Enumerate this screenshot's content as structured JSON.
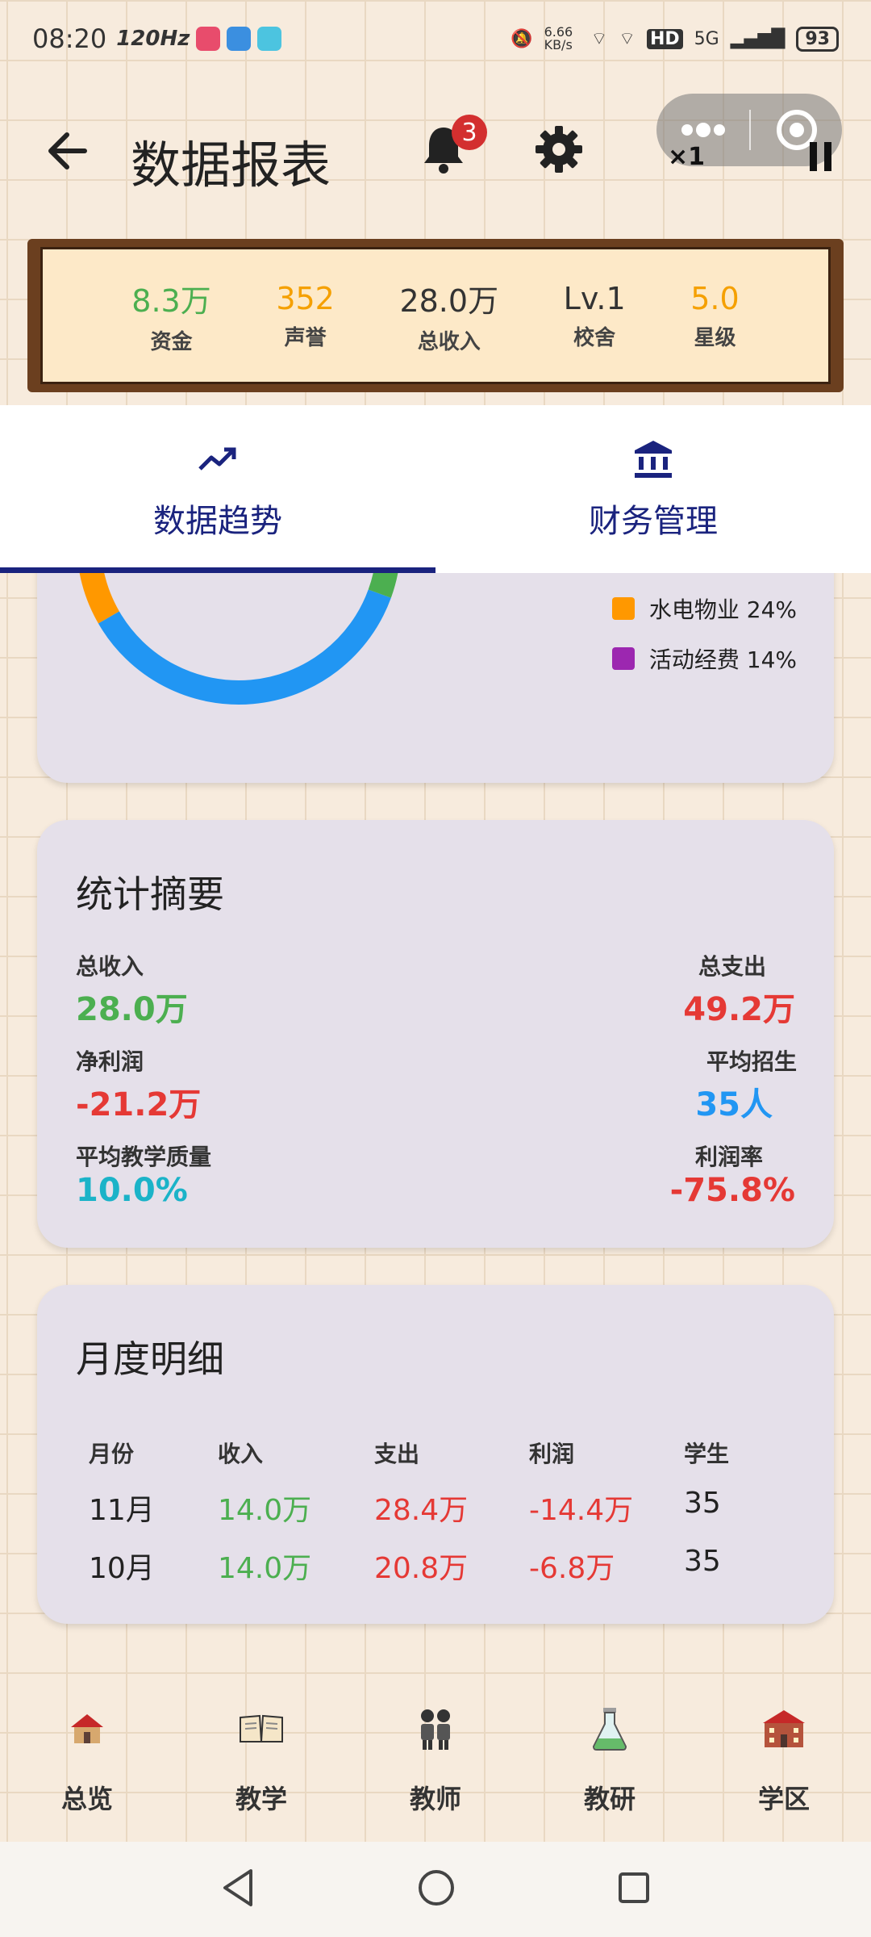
{
  "status_bar": {
    "time": "08:20",
    "refresh_rate": "120Hz",
    "net_speed": "6.66 KB/s",
    "network": "5G",
    "battery": "93"
  },
  "header": {
    "title": "数据报表",
    "notification_count": "3",
    "capsule_speed": "×1"
  },
  "stats": [
    {
      "value": "8.3万",
      "label": "资金",
      "color": "#4caf50"
    },
    {
      "value": "352",
      "label": "声誉",
      "color": "#f5a000"
    },
    {
      "value": "28.0万",
      "label": "总收入",
      "color": "#333333"
    },
    {
      "value": "Lv.1",
      "label": "校舍",
      "color": "#333333"
    },
    {
      "value": "5.0",
      "label": "星级",
      "color": "#f5a000"
    }
  ],
  "tabs": [
    {
      "label": "数据趋势",
      "icon": "trending-up-icon",
      "active": true
    },
    {
      "label": "财务管理",
      "icon": "bank-icon",
      "active": false
    }
  ],
  "expense_chart": {
    "legend": [
      {
        "label": "水电物业 24%",
        "color": "#ff9800"
      },
      {
        "label": "活动经费 14%",
        "color": "#9c27b0"
      }
    ]
  },
  "chart_data": {
    "type": "pie",
    "categories": [
      "水电物业",
      "活动经费"
    ],
    "values": [
      24,
      14
    ],
    "colors": [
      "#ff9800",
      "#9c27b0"
    ],
    "visible_arc_colors": [
      "#ff9800",
      "#2196f3",
      "#4caf50"
    ]
  },
  "summary": {
    "title": "统计摘要",
    "total_income_label": "总收入",
    "total_income_value": "28.0万",
    "total_expense_label": "总支出",
    "total_expense_value": "49.2万",
    "net_profit_label": "净利润",
    "net_profit_value": "-21.2万",
    "avg_enroll_label": "平均招生",
    "avg_enroll_value": "35人",
    "avg_quality_label": "平均教学质量",
    "avg_quality_value": "10.0%",
    "profit_rate_label": "利润率",
    "profit_rate_value": "-75.8%",
    "colors": {
      "positive": "#4caf50",
      "negative": "#e53935",
      "blue": "#2196f3",
      "teal": "#1bb3c8"
    }
  },
  "monthly": {
    "title": "月度明细",
    "headers": [
      "月份",
      "收入",
      "支出",
      "利润",
      "学生"
    ],
    "rows": [
      [
        "11月",
        "14.0万",
        "28.4万",
        "-14.4万",
        "35"
      ],
      [
        "10月",
        "14.0万",
        "20.8万",
        "-6.8万",
        "35"
      ]
    ]
  },
  "bottom_nav": [
    {
      "label": "总览",
      "icon": "house-icon"
    },
    {
      "label": "教学",
      "icon": "book-icon"
    },
    {
      "label": "教师",
      "icon": "teachers-icon"
    },
    {
      "label": "教研",
      "icon": "flask-icon"
    },
    {
      "label": "学区",
      "icon": "school-icon"
    }
  ]
}
